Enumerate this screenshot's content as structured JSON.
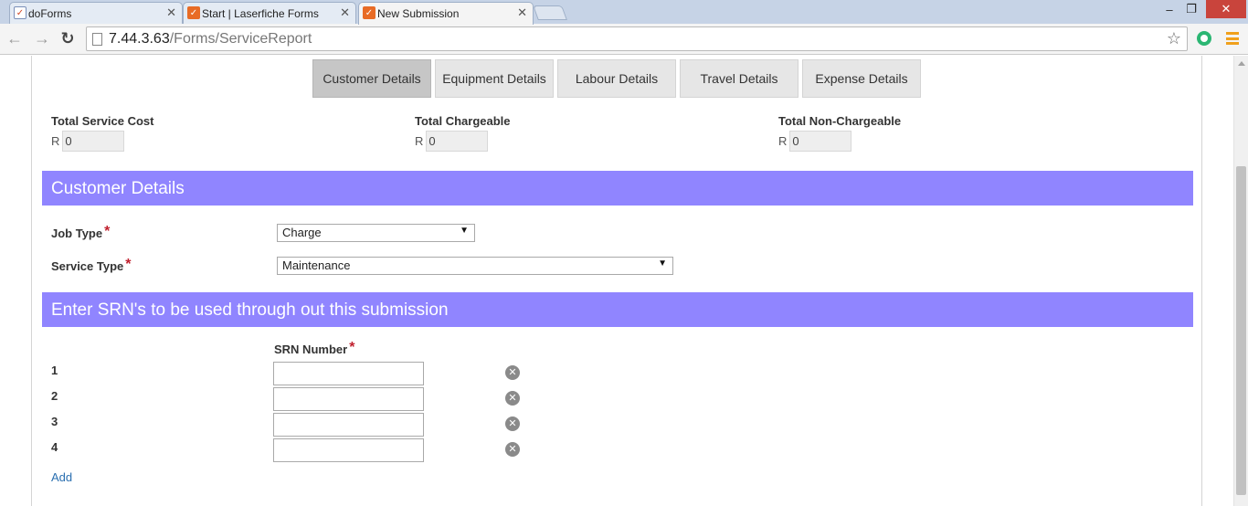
{
  "browser": {
    "tabs": [
      {
        "title": "doForms",
        "icon": "doforms-icon"
      },
      {
        "title": "Start | Laserfiche Forms",
        "icon": "laserfiche-icon"
      },
      {
        "title": "New Submission",
        "icon": "laserfiche-icon"
      }
    ],
    "url_host": "7.44.3.63",
    "url_path": "/Forms/ServiceReport"
  },
  "form": {
    "tabs": [
      {
        "label": "Customer Details",
        "active": true
      },
      {
        "label": "Equipment Details",
        "active": false
      },
      {
        "label": "Labour Details",
        "active": false
      },
      {
        "label": "Travel Details",
        "active": false
      },
      {
        "label": "Expense Details",
        "active": false
      }
    ],
    "totals": [
      {
        "label": "Total Service Cost",
        "currency": "R",
        "value": "0"
      },
      {
        "label": "Total Chargeable",
        "currency": "R",
        "value": "0"
      },
      {
        "label": "Total Non-Chargeable",
        "currency": "R",
        "value": "0"
      }
    ],
    "customer_section": {
      "title": "Customer Details",
      "job_type": {
        "label": "Job Type",
        "value": "Charge"
      },
      "service_type": {
        "label": "Service Type",
        "value": "Maintenance"
      }
    },
    "srn_section": {
      "title": "Enter SRN's to be used through out this submission",
      "column_header": "SRN Number",
      "rows": [
        {
          "num": "1",
          "value": ""
        },
        {
          "num": "2",
          "value": ""
        },
        {
          "num": "3",
          "value": ""
        },
        {
          "num": "4",
          "value": ""
        }
      ],
      "add_label": "Add"
    },
    "required_marker": "*",
    "colors": {
      "section_header": "#9085ff",
      "required": "#c0202e",
      "link": "#2a6fb0"
    }
  }
}
